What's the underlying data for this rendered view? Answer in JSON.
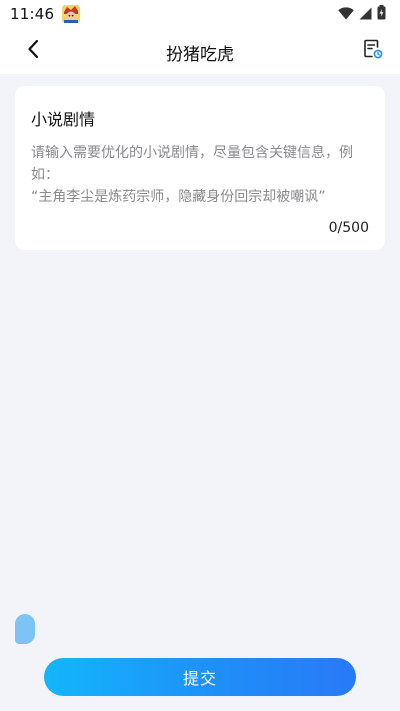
{
  "status_bar": {
    "time": "11:46",
    "icons": [
      "app-avatar-icon",
      "wifi-icon",
      "signal-icon",
      "battery-icon"
    ]
  },
  "nav": {
    "title": "扮猪吃虎",
    "back_icon": "chevron-left-icon",
    "history_icon": "history-list-icon"
  },
  "card": {
    "title": "小说剧情",
    "input_value": "",
    "input_placeholder": "请输入需要优化的小说剧情，尽量包含关键信息，例如：\n“主角李尘是炼药宗师，隐藏身份回宗却被嘲讽”",
    "counter": "0/500"
  },
  "submit_label": "提交",
  "colors": {
    "background": "#f3f4f9",
    "card": "#ffffff",
    "accent_start": "#13b6fb",
    "accent_end": "#2979f6",
    "placeholder": "#8a8a8e",
    "float_handle": "#7dc3f6"
  }
}
